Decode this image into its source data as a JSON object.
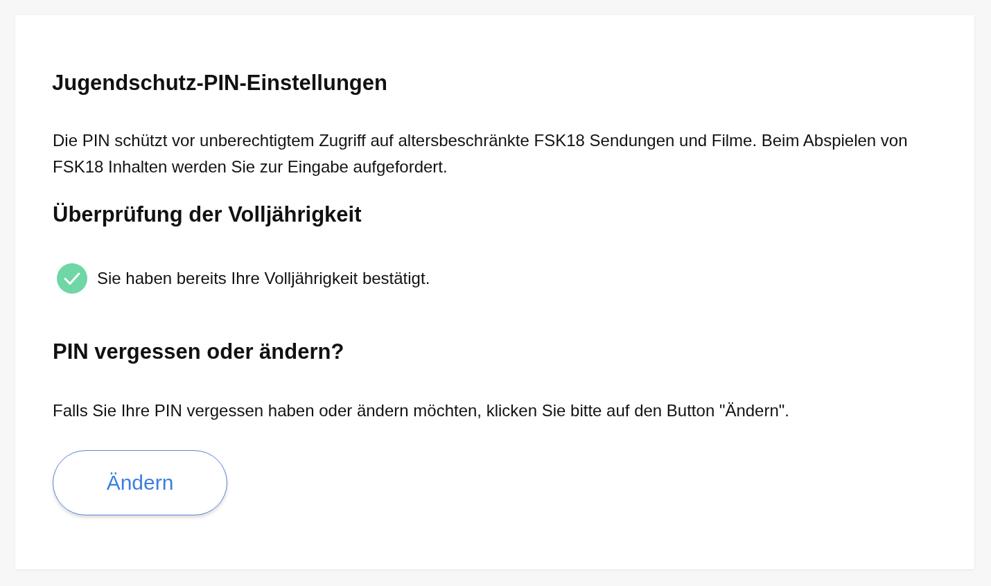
{
  "title": "Jugendschutz-PIN-Einstellungen",
  "intro": "Die PIN schützt vor unberechtigtem Zugriff auf altersbeschränkte FSK18 Sendungen und Filme. Beim Abspielen von FSK18 Inhalten werden Sie zur Eingabe aufgefordert.",
  "verification": {
    "heading": "Überprüfung der Volljährigkeit",
    "verified": true,
    "message": "Sie haben bereits Ihre Volljährigkeit bestätigt."
  },
  "pin": {
    "heading": "PIN vergessen oder ändern?",
    "text": "Falls Sie Ihre PIN vergessen haben oder ändern möchten, klicken Sie bitte auf den Button \"Ändern\".",
    "button": "Ändern"
  }
}
